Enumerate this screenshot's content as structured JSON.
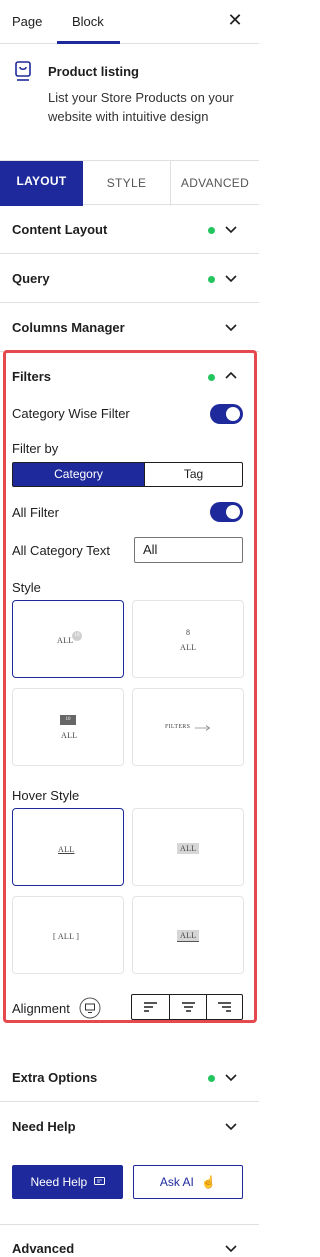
{
  "top_tabs": {
    "page": "Page",
    "block": "Block"
  },
  "block": {
    "title": "Product listing",
    "description": "List your Store Products on your website with intuitive design"
  },
  "main_tabs": {
    "layout": "LAYOUT",
    "style": "STYLE",
    "advanced": "ADVANCED"
  },
  "panels": {
    "content_layout": "Content Layout",
    "query": "Query",
    "columns_manager": "Columns Manager",
    "filters": "Filters",
    "extra_options": "Extra Options",
    "need_help": "Need Help",
    "advanced": "Advanced"
  },
  "filters": {
    "category_wise_filter": "Category Wise Filter",
    "filter_by": "Filter by",
    "filter_by_options": [
      "Category",
      "Tag"
    ],
    "all_filter": "All Filter",
    "all_category_text_label": "All Category Text",
    "all_category_text_value": "All",
    "style_label": "Style",
    "hover_style_label": "Hover Style",
    "alignment_label": "Alignment",
    "preview_all": "ALL",
    "preview_count": "10",
    "preview_count_b": "8",
    "preview_filters": "FILTERS",
    "preview_bracket": "[ ALL ]"
  },
  "buttons": {
    "need_help": "Need Help",
    "ask_ai": "Ask AI"
  },
  "colors": {
    "accent": "#1e2a9c",
    "active_dot": "#22c55e",
    "highlight_border": "#e5484d"
  }
}
